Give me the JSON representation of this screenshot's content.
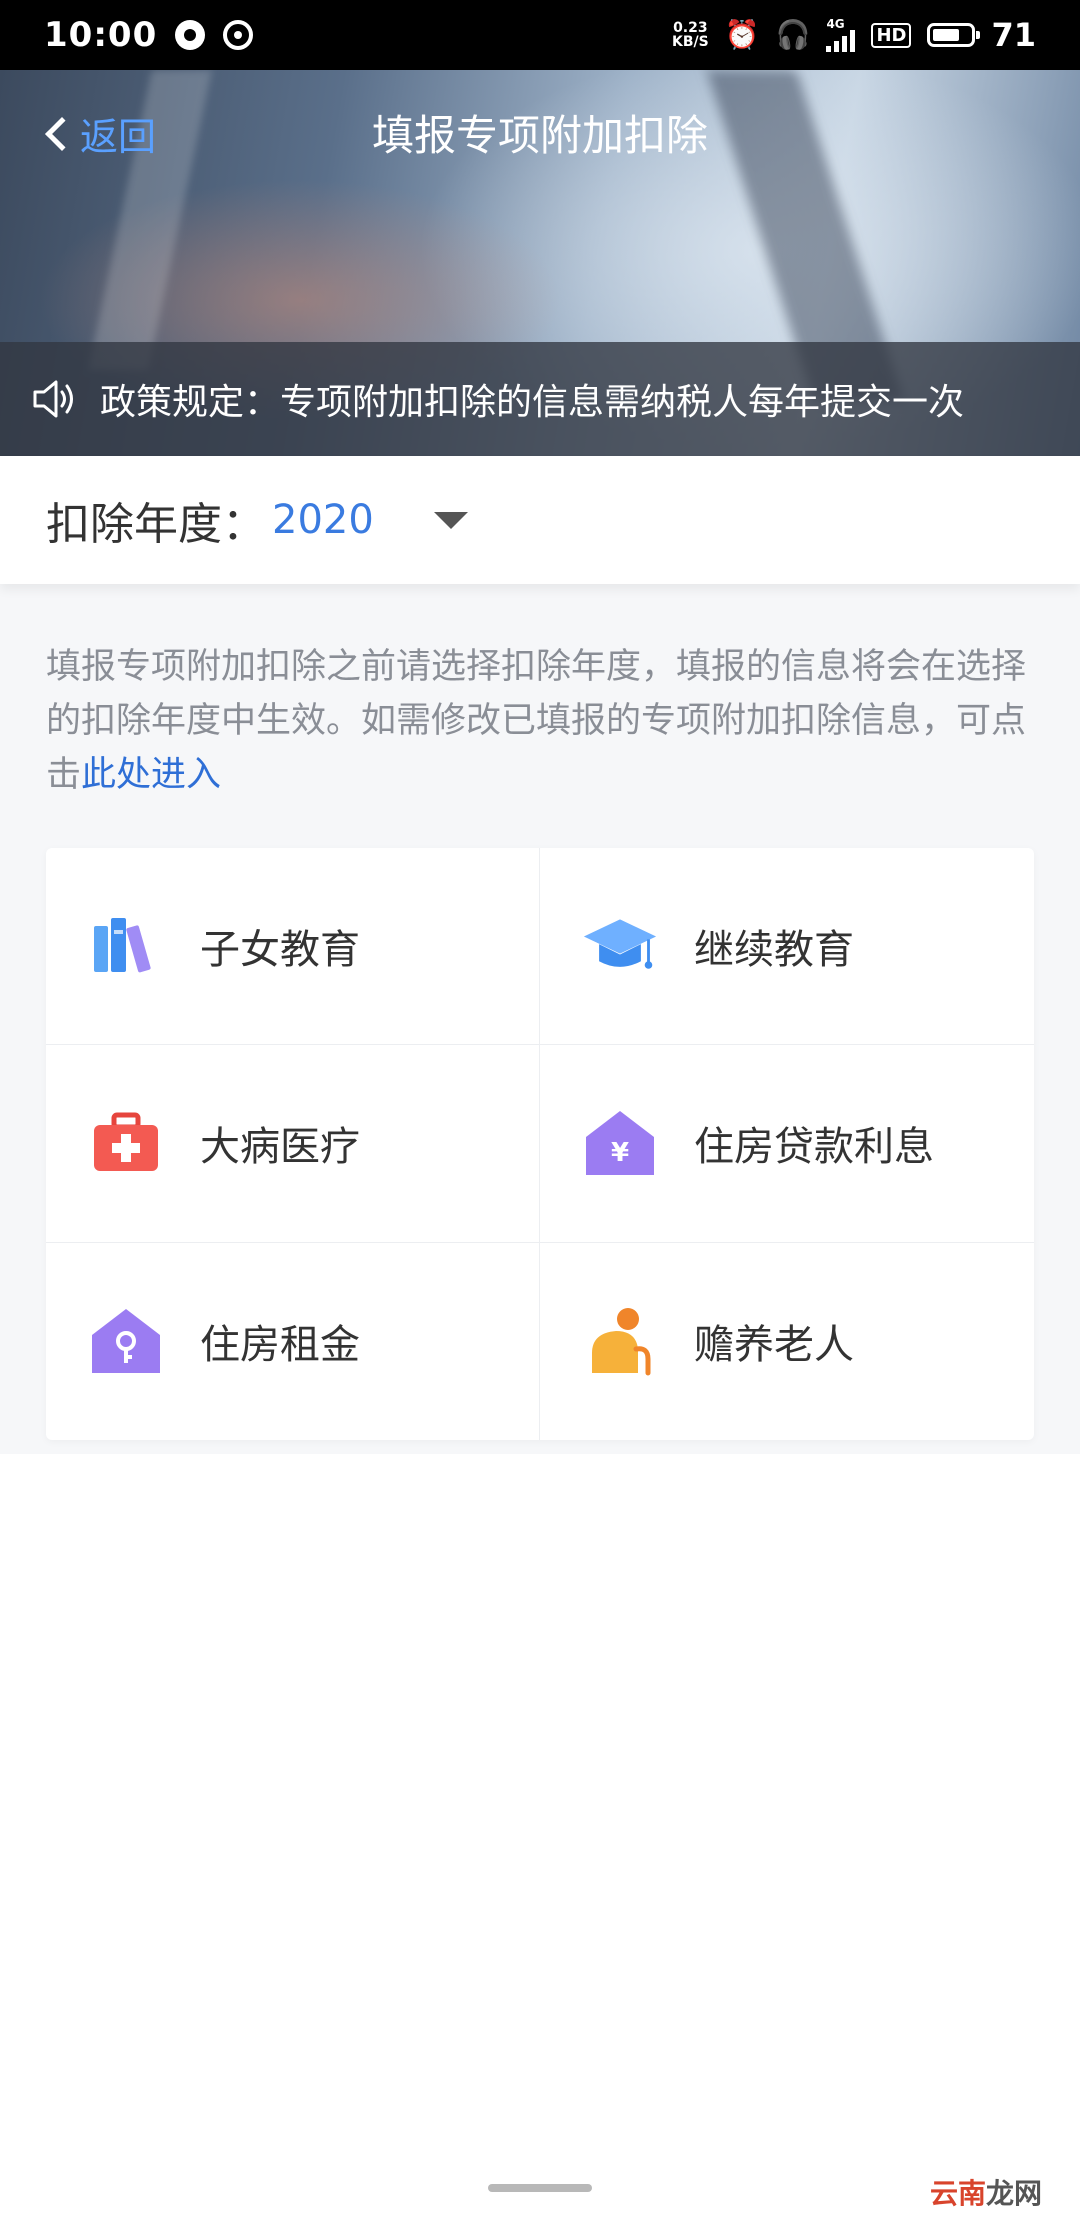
{
  "status_bar": {
    "time": "10:00",
    "net_speed_value": "0.23",
    "net_speed_unit": "KB/S",
    "network_type": "4G",
    "hd_label": "HD",
    "battery_percent": "71",
    "battery_level": 0.71
  },
  "header": {
    "back_label": "返回",
    "title": "填报专项附加扣除"
  },
  "notice": {
    "text": "政策规定：专项附加扣除的信息需纳税人每年提交一次"
  },
  "year_selector": {
    "label": "扣除年度：",
    "value": "2020"
  },
  "hint": {
    "text": "填报专项附加扣除之前请选择扣除年度，填报的信息将会在选择的扣除年度中生效。如需修改已填报的专项附加扣除信息，可点击",
    "link": "此处进入"
  },
  "categories": [
    {
      "label": "子女教育",
      "icon": "books-icon",
      "color": "#5aa5f5"
    },
    {
      "label": "继续教育",
      "icon": "graduation-cap-icon",
      "color": "#4a9af0"
    },
    {
      "label": "大病医疗",
      "icon": "medical-kit-icon",
      "color": "#f35a52"
    },
    {
      "label": "住房贷款利息",
      "icon": "house-loan-icon",
      "color": "#9b7cf2"
    },
    {
      "label": "住房租金",
      "icon": "house-key-icon",
      "color": "#9b7cf2"
    },
    {
      "label": "赡养老人",
      "icon": "elderly-person-icon",
      "color": "#f6a630"
    }
  ],
  "watermark": {
    "brand": "云南",
    "suffix": "龙网"
  }
}
